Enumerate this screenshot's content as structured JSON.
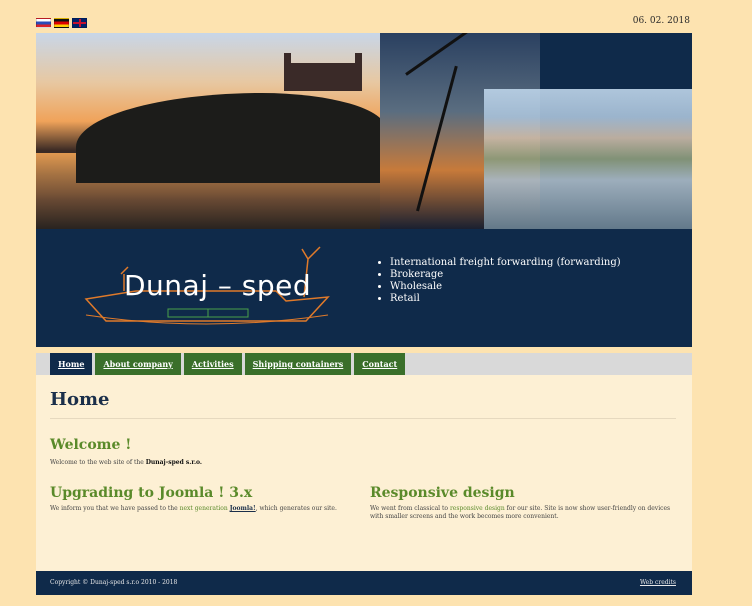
{
  "topbar": {
    "date": "06. 02. 2018",
    "flags": [
      "slovak-flag-icon",
      "german-flag-icon",
      "uk-flag-icon"
    ]
  },
  "brand": {
    "logo_text": "Dunaj – sped",
    "services": [
      "International freight forwarding (forwarding)",
      "Brokerage",
      "Wholesale",
      "Retail"
    ]
  },
  "nav": {
    "items": [
      "Home",
      "About company",
      "Activities",
      "Shipping containers",
      "Contact"
    ],
    "active": "Home"
  },
  "content": {
    "page_title": "Home",
    "welcome": {
      "heading": "Welcome !",
      "text_prefix": "Welcome to the web site of the ",
      "text_company": "Dunaj-sped s.r.o."
    },
    "upgrading": {
      "heading": "Upgrading to Joomla ! 3.x",
      "text_part1": "We inform you that we have passed to the ",
      "text_part2": "next generation",
      "text_link": "Joomla!",
      "text_part3": ", which generates our site."
    },
    "responsive": {
      "heading": "Responsive design",
      "text_part1": "We went from classical to ",
      "text_part2": "responsive design",
      "text_part3": " for our site. Site is now show user-friendly on devices with smaller screens and the work becomes more convenient."
    }
  },
  "footer": {
    "copyright": "Copyright © Dunaj-sped s.r.o 2010 - 2018",
    "credits": "Web credits"
  },
  "colors": {
    "navy": "#0f2a4a",
    "green": "#3a6f2a",
    "heading_green": "#5a8a2a",
    "page_bg": "#fde3b0",
    "content_bg": "#fdf0d4"
  }
}
